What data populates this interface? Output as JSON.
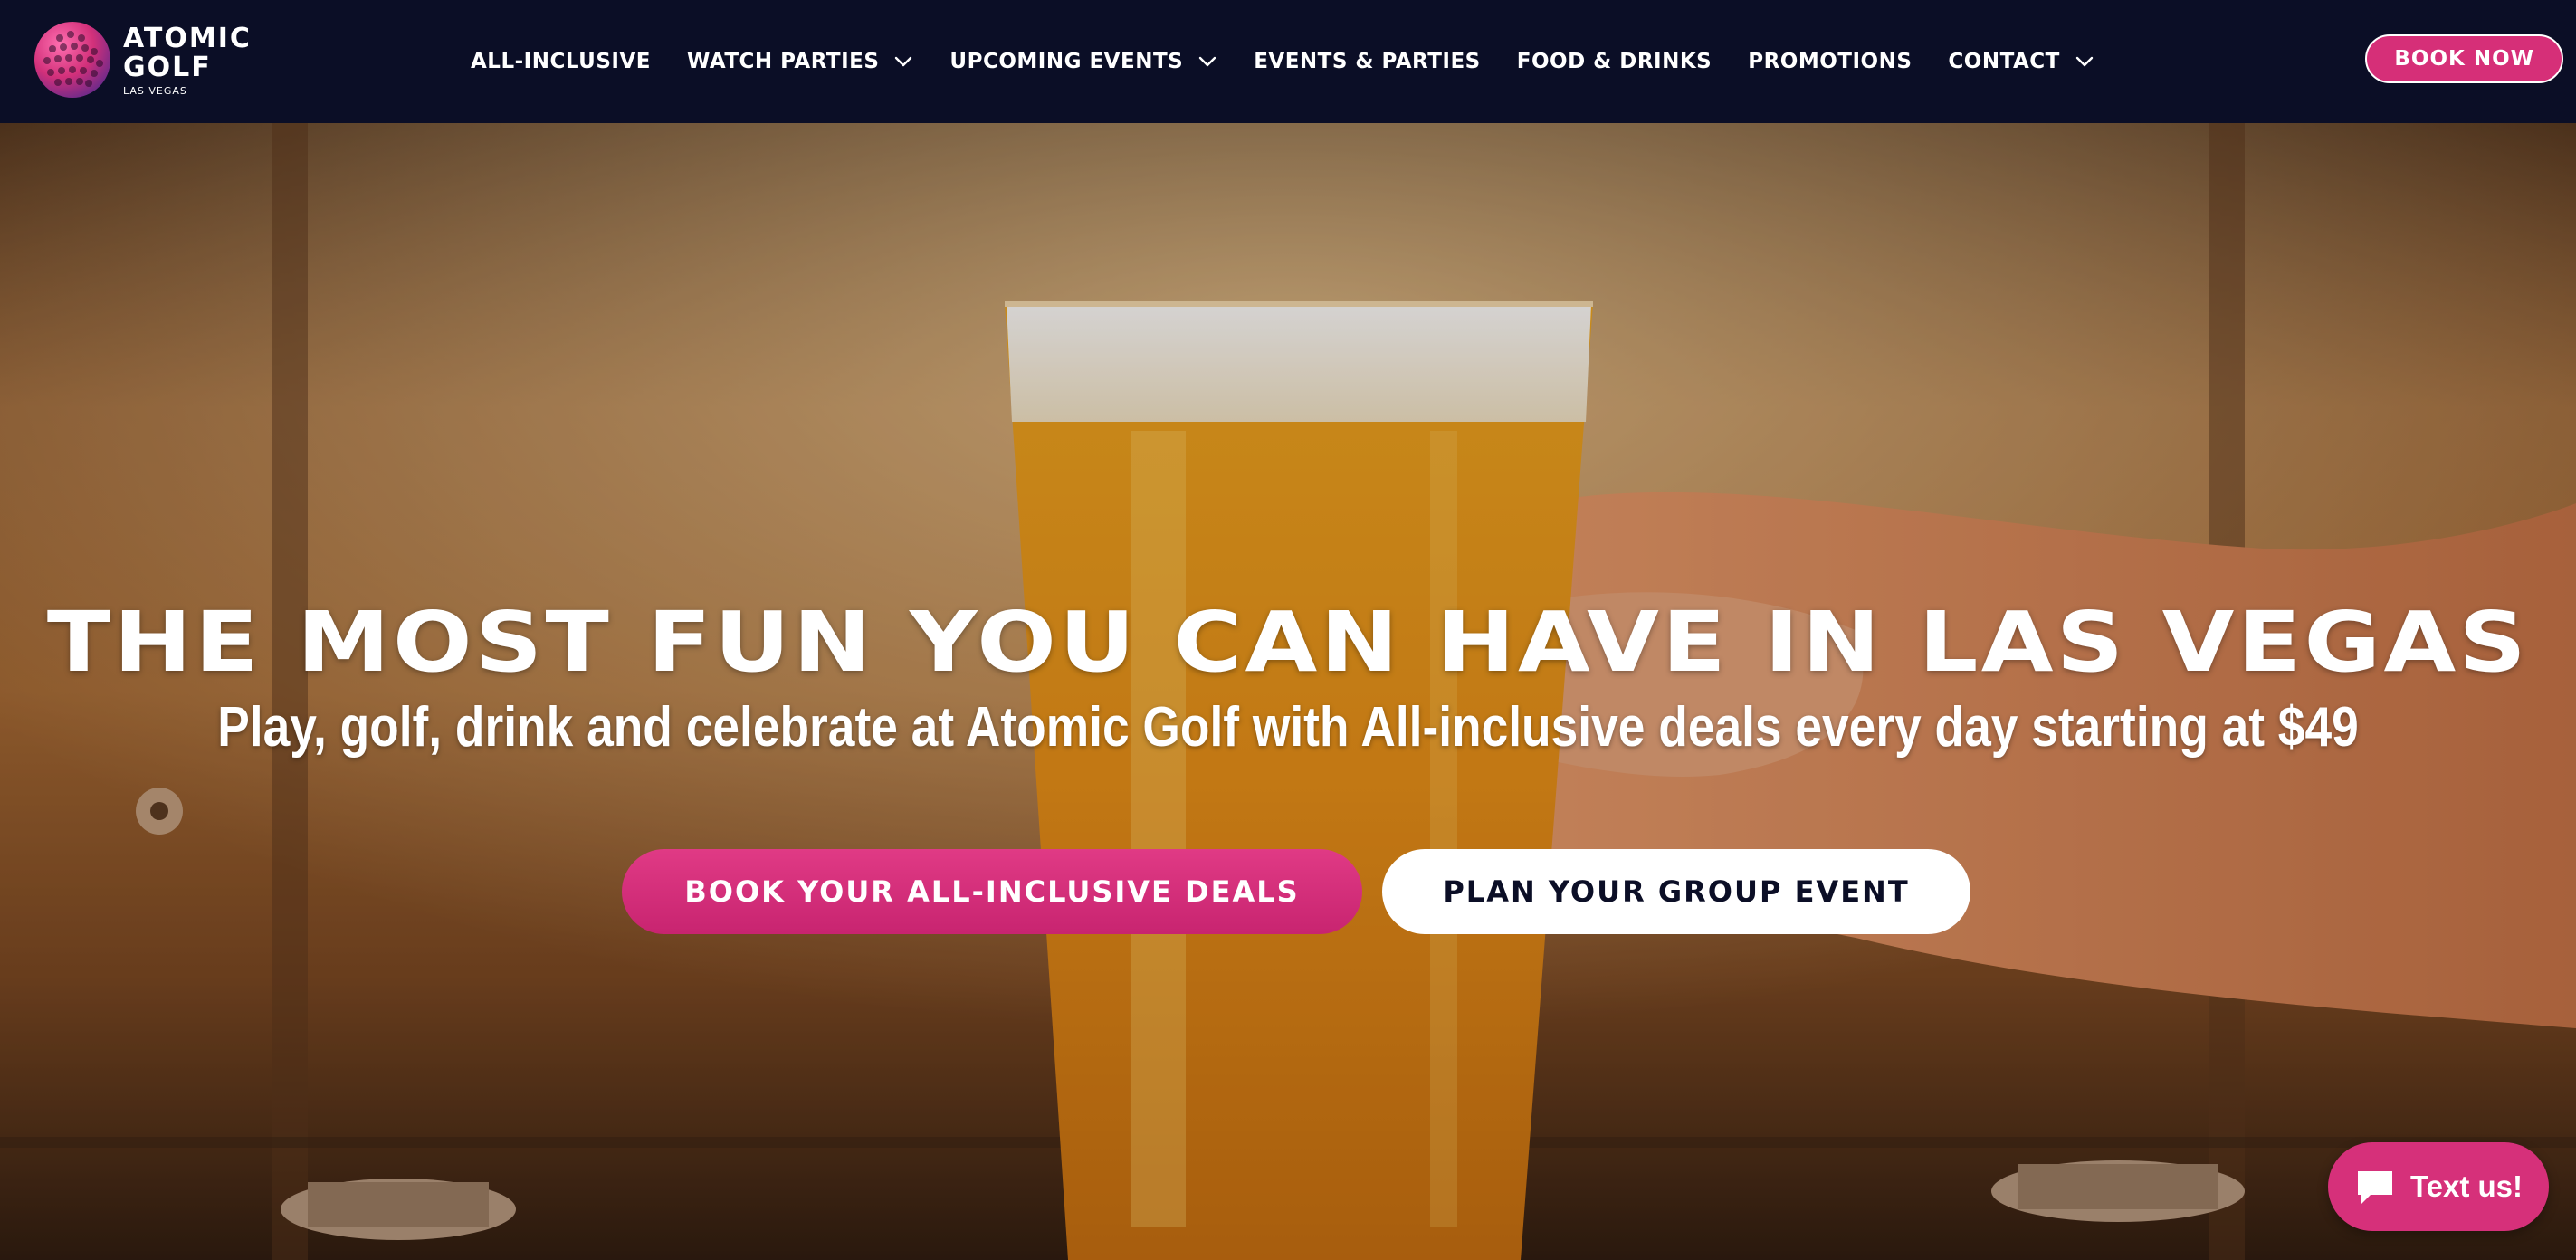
{
  "brand": {
    "name": "ATOMIC\nGOLF",
    "location": "LAS VEGAS",
    "logo_icon": "golf-ball-icon"
  },
  "nav": {
    "items": [
      {
        "label": "ALL-INCLUSIVE",
        "has_dropdown": false
      },
      {
        "label": "WATCH PARTIES",
        "has_dropdown": true
      },
      {
        "label": "UPCOMING EVENTS",
        "has_dropdown": true
      },
      {
        "label": "EVENTS & PARTIES",
        "has_dropdown": false
      },
      {
        "label": "FOOD & DRINKS",
        "has_dropdown": false
      },
      {
        "label": "PROMOTIONS",
        "has_dropdown": false
      },
      {
        "label": "CONTACT",
        "has_dropdown": true
      }
    ],
    "book_now_label": "BOOK NOW"
  },
  "hero": {
    "title": "THE MOST FUN YOU CAN HAVE IN LAS VEGAS",
    "subtitle": "Play, golf, drink and celebrate at Atomic Golf with All-inclusive deals every day starting at $49",
    "primary_cta": "BOOK YOUR ALL-INCLUSIVE DEALS",
    "secondary_cta": "PLAN YOUR GROUP EVENT"
  },
  "chat_widget": {
    "label": "Text us!",
    "icon": "chat-bubble-icon"
  },
  "colors": {
    "nav_bg": "#0b0e26",
    "accent_pink": "#d62f78",
    "white": "#ffffff"
  }
}
